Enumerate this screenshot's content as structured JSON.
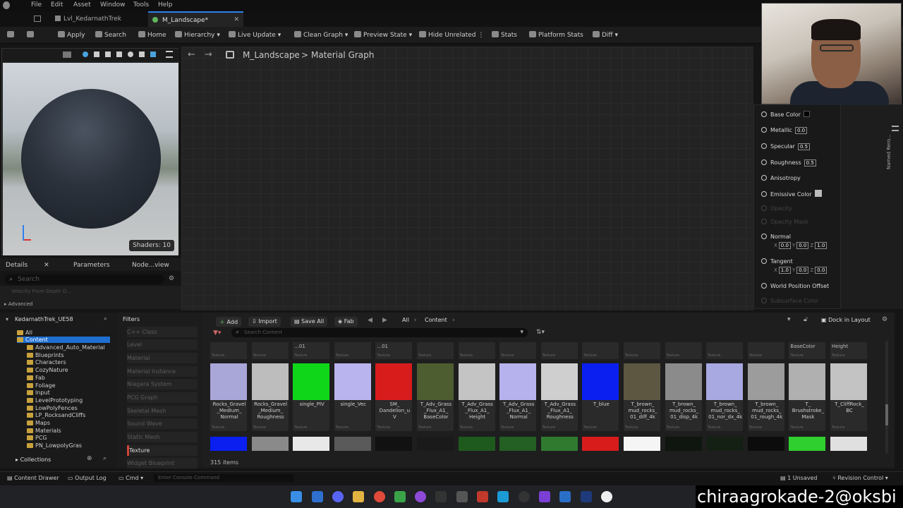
{
  "menu": [
    "File",
    "Edit",
    "Asset",
    "Window",
    "Tools",
    "Help"
  ],
  "tabs": [
    {
      "label": "Lvl_KedarnathTrek"
    },
    {
      "label": "M_Landscape*"
    }
  ],
  "toolbar": {
    "apply": "Apply",
    "search": "Search",
    "home": "Home",
    "hierarchy": "Hierarchy",
    "live_update": "Live Update",
    "clean_graph": "Clean Graph",
    "preview_state": "Preview State",
    "hide_unrelated": "Hide Unrelated",
    "stats": "Stats",
    "platform_stats": "Platform Stats",
    "diff": "Diff"
  },
  "viewport": {
    "shaders": "Shaders: 10"
  },
  "breadcrumb": {
    "root": "M_Landscape",
    "sep": ">",
    "current": "Material Graph"
  },
  "details": {
    "tab_details": "Details",
    "tab_parameters": "Parameters",
    "tab_node": "Node...view",
    "search_placeholder": "Search",
    "row_label": "Velocity From Depth O...",
    "advanced": "Advanced"
  },
  "node": {
    "base_color": "Base Color",
    "metallic": "Metallic",
    "metallic_val": "0.0",
    "specular": "Specular",
    "specular_val": "0.5",
    "roughness": "Roughness",
    "roughness_val": "0.5",
    "anisotropy": "Anisotropy",
    "emissive": "Emissive Color",
    "opacity": "Opacity",
    "opacity_mask": "Opacity Mask",
    "normal": "Normal",
    "normal_x": "0.0",
    "normal_y": "0.0",
    "normal_z": "1.0",
    "tangent": "Tangent",
    "tangent_x": "1.0",
    "tangent_y": "0.0",
    "tangent_z": "0.0",
    "wpo": "World Position Offset",
    "subsurface": "Subsurface Color"
  },
  "right_strip": {
    "label": "Named Rero..."
  },
  "tree": {
    "root": "KedarnathTrek_UE58",
    "items": [
      "All",
      "Content",
      "Advanced_Auto_Material",
      "Blueprints",
      "Characters",
      "CozyNature",
      "Fab",
      "Foliage",
      "Input",
      "LevelPrototyping",
      "LowPolyFences",
      "LP_RocksandCliffs",
      "Maps",
      "Materials",
      "PCG",
      "PN_LowpolyGras"
    ],
    "collections": "Collections"
  },
  "filters": {
    "title": "Filters",
    "items": [
      "C++ Class",
      "Level",
      "Material",
      "Material Instance",
      "Niagara System",
      "PCG Graph",
      "Skeletal Mesh",
      "Sound Wave",
      "Static Mesh",
      "Texture",
      "Widget Blueprint"
    ]
  },
  "content": {
    "add": "Add",
    "import": "Import",
    "save_all": "Save All",
    "fab": "Fab",
    "path_all": "All",
    "path_content": "Content",
    "search_placeholder": "Search Content",
    "dock": "Dock in Layout",
    "count": "315 items",
    "top_row": [
      {
        "name": "",
        "type": "Texture"
      },
      {
        "name": "",
        "type": "Texture"
      },
      {
        "name": "...01",
        "type": "Texture"
      },
      {
        "name": "",
        "type": "Texture"
      },
      {
        "name": "...01",
        "type": "Texture"
      },
      {
        "name": "",
        "type": "Texture"
      },
      {
        "name": "",
        "type": "Texture"
      },
      {
        "name": "",
        "type": "Texture"
      },
      {
        "name": "",
        "type": "Texture"
      },
      {
        "name": "",
        "type": "Texture"
      },
      {
        "name": "",
        "type": "Texture"
      },
      {
        "name": "",
        "type": "Texture"
      },
      {
        "name": "",
        "type": "Texture"
      },
      {
        "name": "",
        "type": "Texture"
      },
      {
        "name": "BaseColor",
        "type": "Texture"
      },
      {
        "name": "Height",
        "type": "Texture"
      }
    ],
    "assets": [
      {
        "name": "Rocks_Gravel\n_Medium_\nNormal",
        "type": "Texture",
        "color": "#a9a6d8"
      },
      {
        "name": "Rocks_Gravel\n_Medium_\nRoughness",
        "type": "Texture",
        "color": "#bdbdbd"
      },
      {
        "name": "single_PIV",
        "type": "Texture",
        "color": "#10d61a"
      },
      {
        "name": "single_Vec",
        "type": "Texture",
        "color": "#b9b4ee"
      },
      {
        "name": "SM_\nDandelion_u\nV",
        "type": "Texture",
        "color": "#d81c1c"
      },
      {
        "name": "T_Adv_Grass\n_Flux_A1_\nBaseColor",
        "type": "Texture",
        "color": "#4d5d2f"
      },
      {
        "name": "T_Adv_Grass\n_Flux_A1_\nHeight",
        "type": "Texture",
        "color": "#c4c4c4"
      },
      {
        "name": "T_Adv_Grass\n_Flux_A1_\nNormal",
        "type": "Texture",
        "color": "#b6b2ee"
      },
      {
        "name": "T_Adv_Grass\n_Flux_A1_\nRoughness",
        "type": "Texture",
        "color": "#cfcfcf"
      },
      {
        "name": "T_blue",
        "type": "Texture",
        "color": "#0a1ff0"
      },
      {
        "name": "T_brown_\nmud_rocks_\n01_diff_4k",
        "type": "Texture",
        "color": "#5d5640"
      },
      {
        "name": "T_brown_\nmud_rocks_\n01_disp_4k",
        "type": "Texture",
        "color": "#8b8b8b"
      },
      {
        "name": "T_brown_\nmud_rocks_\n01_nor_dx_4k",
        "type": "Texture",
        "color": "#a7a9e0"
      },
      {
        "name": "T_brown_\nmud_rocks_\n01_rough_4k",
        "type": "Texture",
        "color": "#9c9c9c"
      },
      {
        "name": "T_\nBrushstroke_\nMask",
        "type": "Texture",
        "color": "#b0b0b0"
      },
      {
        "name": "T_CliffRock_\nBC",
        "type": "Texture",
        "color": "#c3c3c3"
      }
    ],
    "bottom_row": [
      {
        "color": "#0a1ff0"
      },
      {
        "color": "#8a8a8a"
      },
      {
        "color": "#e8e8e8"
      },
      {
        "color": "#5a5a5a"
      },
      {
        "color": "#111111"
      },
      {
        "color": "#1a1a1a"
      },
      {
        "color": "#1e5a1e"
      },
      {
        "color": "#245f24"
      },
      {
        "color": "#2f7a2f"
      },
      {
        "color": "#d81c1c"
      },
      {
        "color": "#f5f5f5"
      },
      {
        "color": "#0f150f"
      },
      {
        "color": "#142014"
      },
      {
        "color": "#0c0c0c"
      },
      {
        "color": "#2fcf2f"
      },
      {
        "color": "#e0e0e0"
      }
    ]
  },
  "status": {
    "content_drawer": "Content Drawer",
    "output_log": "Output Log",
    "cmd": "Cmd",
    "console_placeholder": "Enter Console Command",
    "unsaved": "1 Unsaved",
    "revision": "Revision Control"
  },
  "overlay": {
    "text": "chiraagrokade-2@oksbi"
  },
  "colors": {
    "accent": "#2f80ed",
    "selected": "#1f6fd1"
  }
}
